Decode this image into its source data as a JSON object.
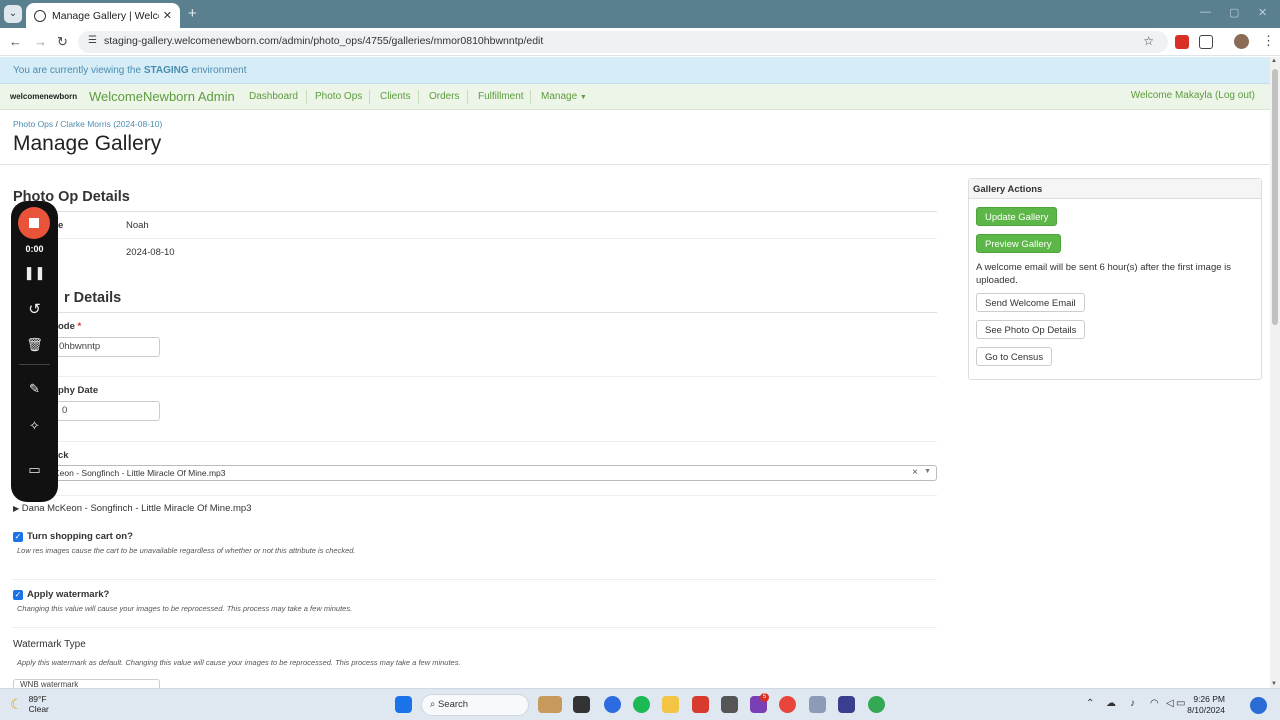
{
  "browser": {
    "tab_title": "Manage Gallery | WelcomeNe",
    "url": "staging-gallery.welcomenewborn.com/admin/photo_ops/4755/galleries/mmor0810hbwnntp/edit"
  },
  "environment": {
    "prefix": "You are currently viewing the",
    "name": "STAGING",
    "suffix": "environment"
  },
  "nav": {
    "logo": "welcomenewborn",
    "brand": "WelcomeNewborn Admin",
    "items": [
      "Dashboard",
      "Photo Ops",
      "Clients",
      "Orders",
      "Fulfillment",
      "Manage"
    ],
    "welcome": "Welcome Makayla (Log out)"
  },
  "breadcrumb": {
    "first": "Photo Ops",
    "sep": "/",
    "second": "Clarke Morris (2024-08-10)"
  },
  "page_title": "Manage Gallery",
  "photo_op": {
    "heading": "Photo Op Details",
    "rows": [
      {
        "label": "e",
        "value": "Noah"
      },
      {
        "label": "",
        "value": "2024-08-10"
      }
    ]
  },
  "gallery": {
    "heading": "r Details",
    "code_label": "ode",
    "code_required": "*",
    "code_value": "0hbwnntp",
    "date_label": "phy Date",
    "date_value": "0",
    "track_label": "ck",
    "track_value": "Keon - Songfinch - Little Miracle Of Mine.mp3",
    "track_clear": "×",
    "track_arrow": "▼",
    "track_full": "Dana McKeon - Songfinch - Little Miracle Of Mine.mp3",
    "cart_label": "Turn shopping cart on?",
    "cart_help": "Low res images cause the cart to be unavailable regardless of whether or not this attribute is checked.",
    "wm_label": "Apply watermark?",
    "wm_help": "Changing this value will cause your images to be reprocessed. This process may take a few minutes.",
    "wm_type_label": "Watermark Type",
    "wm_type_help": "Apply this watermark as default. Changing this value will cause your images to be reprocessed. This process may take a few minutes.",
    "wm_type_value": "WNB watermark"
  },
  "recorder": {
    "time": "0:00"
  },
  "actions": {
    "title": "Gallery Actions",
    "update": "Update Gallery",
    "preview": "Preview Gallery",
    "note": "A welcome email will be sent 6 hour(s) after the first image is uploaded.",
    "send_email": "Send Welcome Email",
    "see_details": "See Photo Op Details",
    "census": "Go to Census"
  },
  "taskbar": {
    "temp": "89°F",
    "condition": "Clear",
    "search": "Search",
    "badge": "5",
    "time": "9:26 PM",
    "date": "8/10/2024"
  },
  "colors": {
    "accent_green": "#5cb648",
    "link_blue": "#4b8db0",
    "brand_green": "#5c9c3e"
  }
}
